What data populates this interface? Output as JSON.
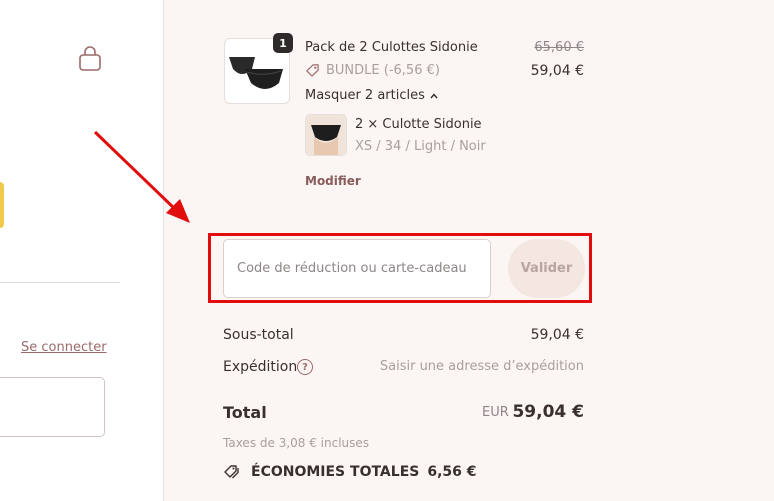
{
  "left": {
    "login_link": "Se connecter"
  },
  "product": {
    "qty_badge": "1",
    "title": "Pack de 2 Culottes Sidonie",
    "compare_price": "65,60 €",
    "price": "59,04 €",
    "discount_label": "BUNDLE (-6,56 €)",
    "toggle_label": "Masquer 2 articles",
    "sub_item": {
      "name": "2 × Culotte Sidonie",
      "variant": "XS / 34 / Light / Noir"
    },
    "modify_label": "Modifier"
  },
  "discount": {
    "placeholder": "Code de réduction ou carte-cadeau",
    "apply_label": "Valider"
  },
  "summary": {
    "subtotal_label": "Sous-total",
    "subtotal_value": "59,04 €",
    "shipping_label": "Expédition",
    "shipping_info": "?",
    "shipping_value": "Saisir une adresse d’expédition",
    "total_label": "Total",
    "total_currency": "EUR",
    "total_value": "59,04 €",
    "tax_note": "Taxes de 3,08 € incluses",
    "savings_label": "ÉCONOMIES TOTALES",
    "savings_value": "6,56 €"
  },
  "colors": {
    "accent": "#9c6a6a",
    "highlight": "#e10d0d",
    "panel_bg": "#fbf6f3"
  }
}
